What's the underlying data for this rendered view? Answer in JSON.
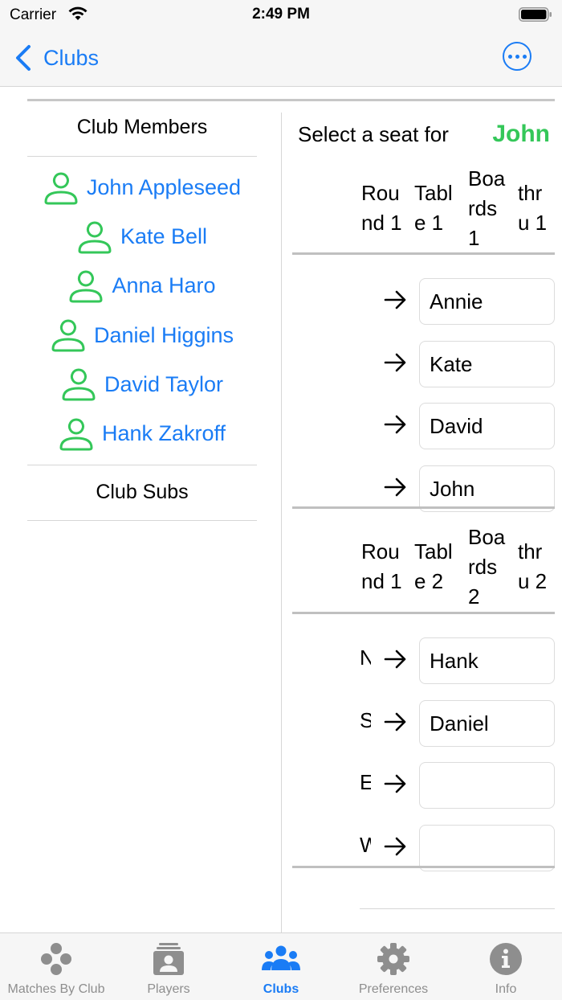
{
  "status_bar": {
    "carrier": "Carrier",
    "time": "2:49 PM"
  },
  "nav": {
    "back_label": "Clubs"
  },
  "left": {
    "members_title": "Club Members",
    "members": [
      {
        "name": "John Appleseed"
      },
      {
        "name": "Kate Bell"
      },
      {
        "name": "Anna Haro"
      },
      {
        "name": "Daniel Higgins"
      },
      {
        "name": "David Taylor"
      },
      {
        "name": "Hank Zakroff"
      }
    ],
    "subs_title": "Club Subs"
  },
  "right": {
    "select_label": "Select a seat for",
    "selected_player": "John",
    "tables": [
      {
        "header": {
          "round": "Rou\nnd 1",
          "table": "Tabl\ne 1",
          "boards": "Boa\nrds\n1",
          "thru": "thr\nu 1"
        },
        "seats": [
          {
            "dir": "",
            "value": "Annie"
          },
          {
            "dir": "",
            "value": "Kate"
          },
          {
            "dir": "",
            "value": "David"
          },
          {
            "dir": "",
            "value": "John"
          }
        ]
      },
      {
        "header": {
          "round": "Rou\nnd 1",
          "table": "Tabl\ne 2",
          "boards": "Boa\nrds\n2",
          "thru": "thr\nu 2"
        },
        "seats": [
          {
            "dir": "N",
            "value": "Hank"
          },
          {
            "dir": "S",
            "value": "Daniel"
          },
          {
            "dir": "E",
            "value": ""
          },
          {
            "dir": "W",
            "value": ""
          }
        ]
      }
    ]
  },
  "colors": {
    "accent": "#1a7cf5",
    "player_green": "#34c759",
    "inactive": "#8e8e8e"
  },
  "tab_bar": {
    "tabs": [
      {
        "label": "Matches By Club",
        "icon": "matches-icon"
      },
      {
        "label": "Players",
        "icon": "players-icon"
      },
      {
        "label": "Clubs",
        "icon": "clubs-icon",
        "active": true
      },
      {
        "label": "Preferences",
        "icon": "gear-icon"
      },
      {
        "label": "Info",
        "icon": "info-icon"
      }
    ]
  }
}
